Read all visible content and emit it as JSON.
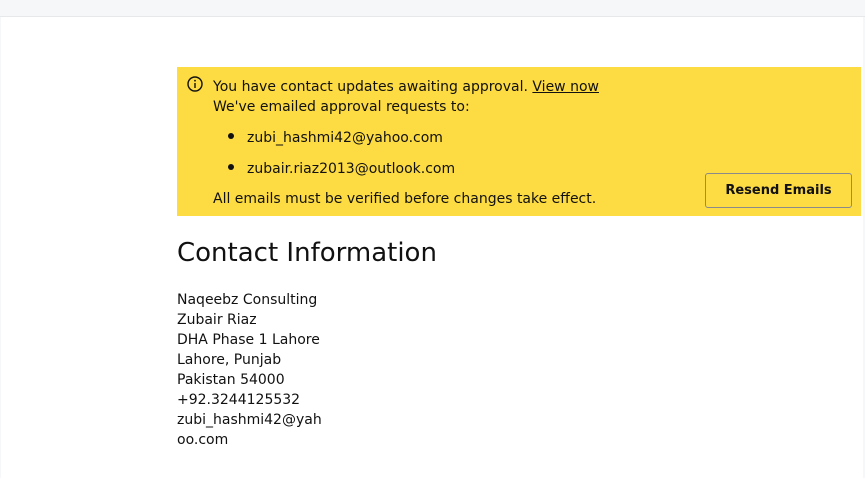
{
  "notice": {
    "message": "You have contact updates awaiting approval.",
    "link_label": "View now",
    "emailed_label": "We've emailed approval requests to:",
    "emails": [
      "zubi_hashmi42@yahoo.com",
      "zubair.riaz2013@outlook.com"
    ],
    "footer": "All emails must be verified before changes take effect.",
    "resend_label": "Resend Emails",
    "background_color": "#fddb43",
    "icon": "info-icon"
  },
  "contact": {
    "title": "Contact Information",
    "company": "Naqeebz Consulting",
    "name": "Zubair Riaz",
    "address1": "DHA Phase 1 Lahore",
    "city_region": "Lahore, Punjab",
    "country_postal": "Pakistan 54000",
    "phone": "+92.3244125532",
    "email": "zubi_hashmi42@yahoo.com"
  }
}
